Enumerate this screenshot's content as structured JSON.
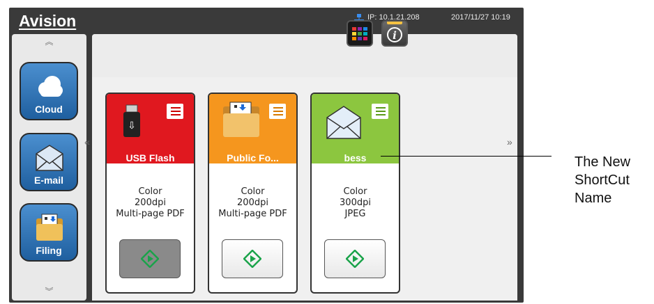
{
  "header": {
    "logo": "Avision",
    "ip": "IP: 10.1.21.208",
    "datetime": "2017/11/27 10:19",
    "network_icon": "network-icon"
  },
  "sidebar": {
    "scroll_up": "︽",
    "scroll_down": "︾",
    "items": [
      {
        "label": "Cloud",
        "icon": "cloud-icon"
      },
      {
        "label": "E-mail",
        "icon": "envelope-icon"
      },
      {
        "label": "Filing",
        "icon": "folder-icon"
      }
    ]
  },
  "toolbar": {
    "grid_icon": "color-grid-icon",
    "info_icon": "info-icon"
  },
  "navigation": {
    "prev": "«",
    "next": "»"
  },
  "cards": [
    {
      "title": "USB Flash",
      "color": "#e0181f",
      "icon": "usb-icon",
      "settings": [
        "Color",
        "200dpi",
        "Multi-page PDF"
      ],
      "start_icon": "start-icon"
    },
    {
      "title": "Public Fo...",
      "color": "#f5961e",
      "icon": "folder-icon",
      "settings": [
        "Color",
        "200dpi",
        "Multi-page PDF"
      ],
      "start_icon": "start-icon"
    },
    {
      "title": "bess",
      "color": "#8cc63f",
      "icon": "envelope-icon",
      "settings": [
        "Color",
        "300dpi",
        "JPEG"
      ],
      "start_icon": "start-icon"
    }
  ],
  "callout": {
    "lines": [
      "The New",
      "ShortCut",
      "Name"
    ]
  },
  "colors": {
    "accent_green": "#1aa34a"
  }
}
